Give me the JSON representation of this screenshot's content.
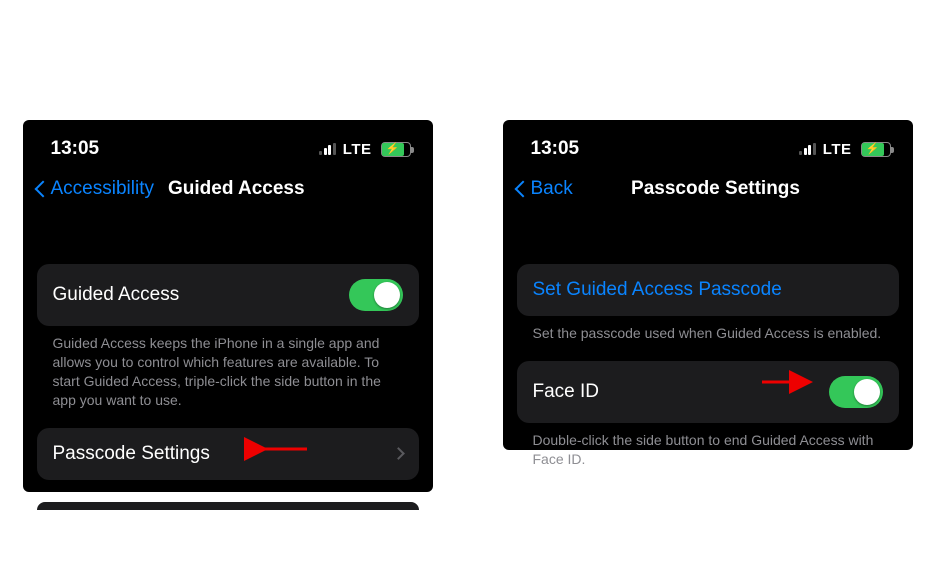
{
  "left": {
    "status": {
      "time": "13:05",
      "network": "LTE"
    },
    "nav": {
      "back": "Accessibility",
      "title": "Guided Access"
    },
    "toggleRow": {
      "label": "Guided Access"
    },
    "description": "Guided Access keeps the iPhone in a single app and allows you to control which features are available. To start Guided Access, triple-click the side button in the app you want to use.",
    "passcodeRow": {
      "label": "Passcode Settings"
    }
  },
  "right": {
    "status": {
      "time": "13:05",
      "network": "LTE"
    },
    "nav": {
      "back": "Back",
      "title": "Passcode Settings"
    },
    "setRow": {
      "label": "Set Guided Access Passcode"
    },
    "setFooter": "Set the passcode used when Guided Access is enabled.",
    "faceRow": {
      "label": "Face ID"
    },
    "faceFooter": "Double-click the side button to end Guided Access with Face ID."
  }
}
